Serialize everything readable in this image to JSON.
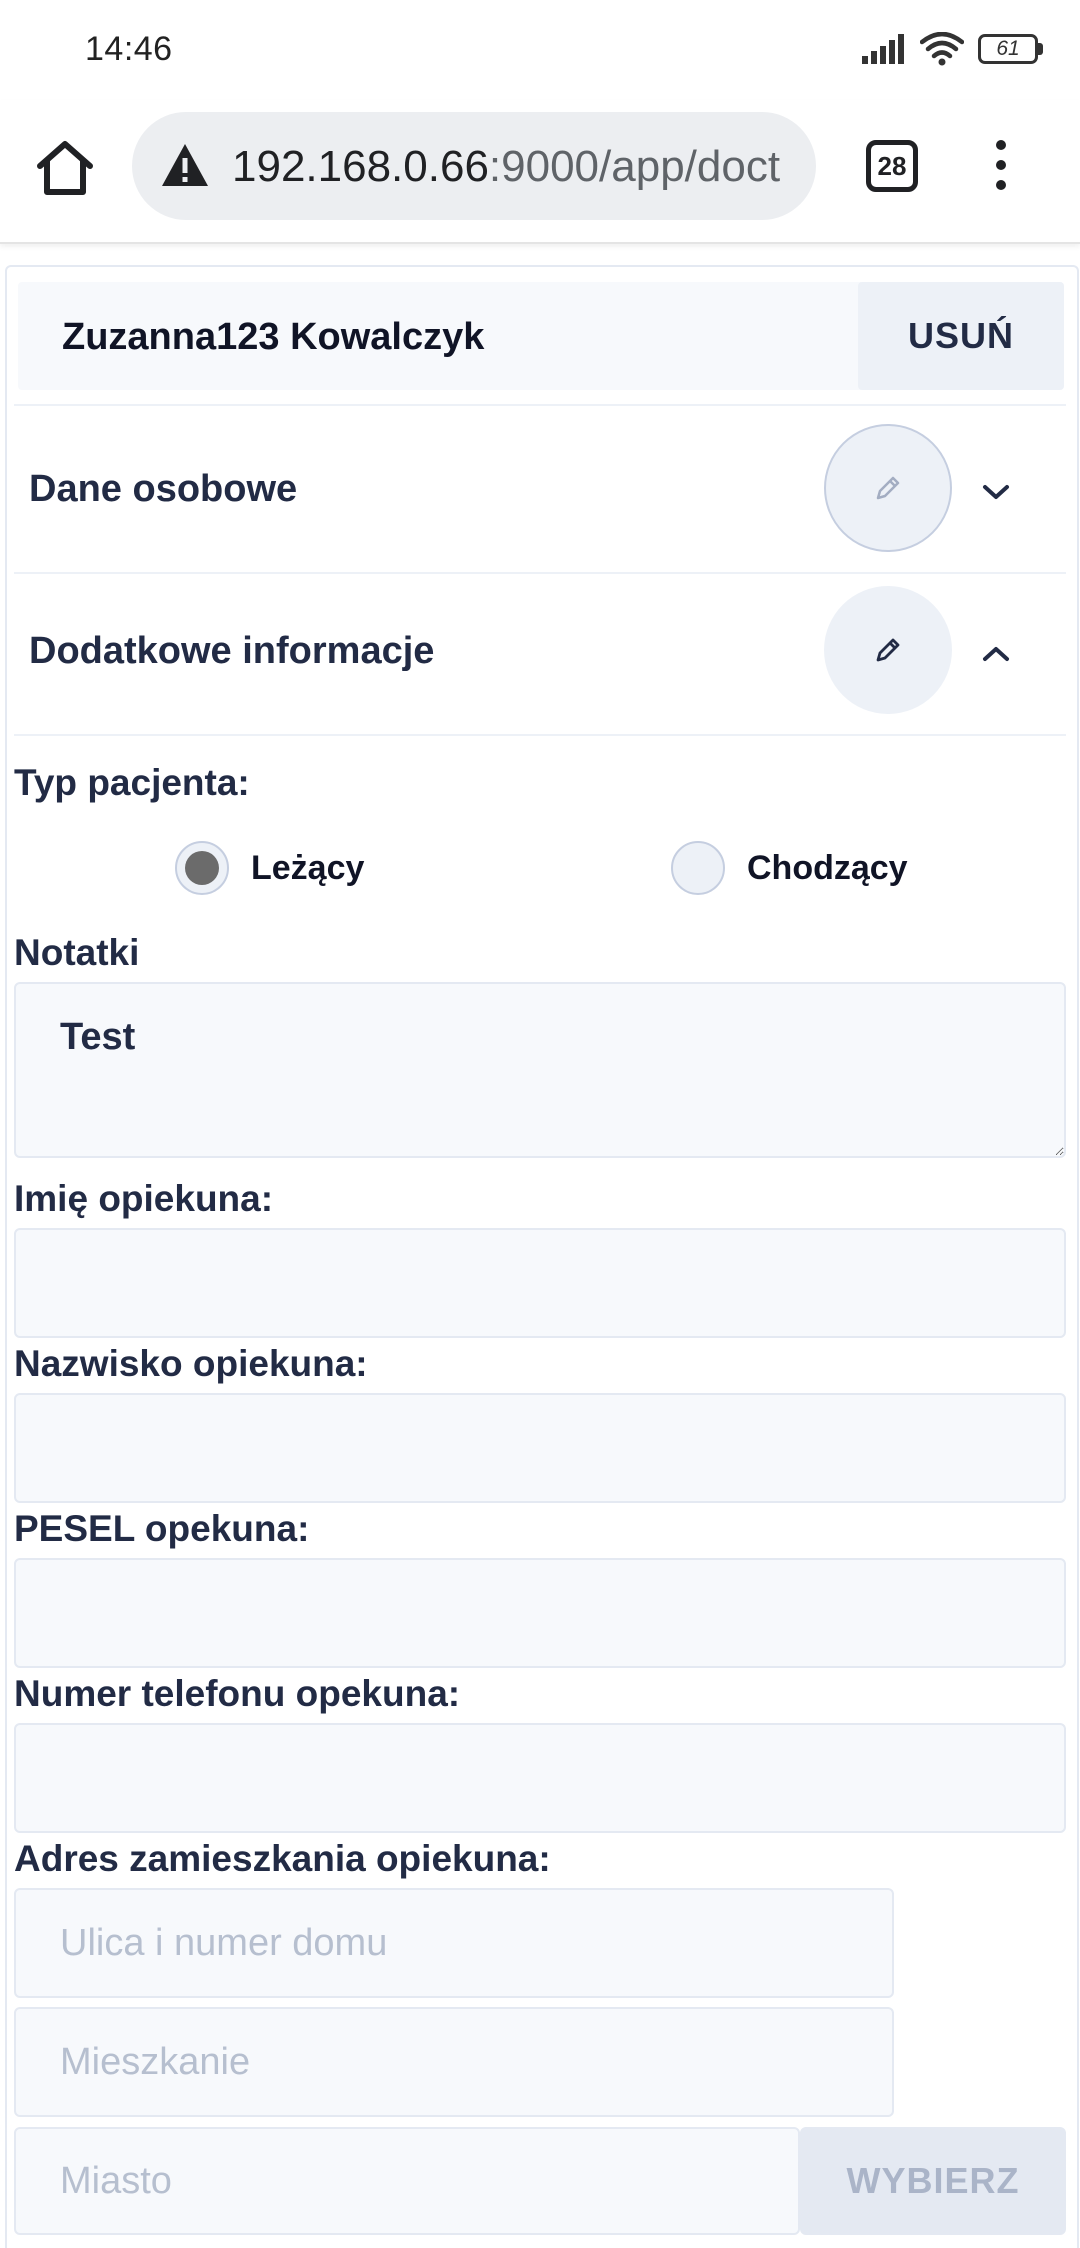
{
  "status_bar": {
    "time": "14:46",
    "battery": "61",
    "icons": [
      "signal-icon",
      "wifi-icon",
      "battery-icon"
    ]
  },
  "browser": {
    "url_host": "192.168.0.66",
    "url_rest": ":9000/app/doct",
    "tabs_count": "28",
    "icons": [
      "home-icon",
      "warning-icon",
      "more-vert-icon"
    ]
  },
  "patient": {
    "name": "Zuzanna123 Kowalczyk",
    "delete_label": "USUŃ"
  },
  "sections": {
    "personal": {
      "title": "Dane osobowe",
      "expanded": false
    },
    "additional": {
      "title": "Dodatkowe informacje",
      "expanded": true
    }
  },
  "form": {
    "patient_type_label": "Typ pacjenta:",
    "patient_type_options": [
      {
        "label": "Leżący",
        "selected": true
      },
      {
        "label": "Chodzący",
        "selected": false
      }
    ],
    "notes_label": "Notatki",
    "notes_value": "Test",
    "guardian_first_name_label": "Imię opiekuna:",
    "guardian_first_name_value": "",
    "guardian_last_name_label": "Nazwisko opiekuna:",
    "guardian_last_name_value": "",
    "guardian_pesel_label": "PESEL opekuna:",
    "guardian_pesel_value": "",
    "guardian_phone_label": "Numer telefonu opekuna:",
    "guardian_phone_value": "",
    "guardian_address_label": "Adres zamieszkania opiekuna:",
    "street_placeholder": "Ulica i numer domu",
    "apartment_placeholder": "Mieszkanie",
    "city_placeholder": "Miasto",
    "choose_label": "WYBIERZ"
  },
  "colors": {
    "text": "#222b45",
    "input_bg": "#f7f9fc",
    "input_border": "#e4e9f2",
    "button_bg": "#edf1f7",
    "disabled_text": "#aab4c8"
  }
}
